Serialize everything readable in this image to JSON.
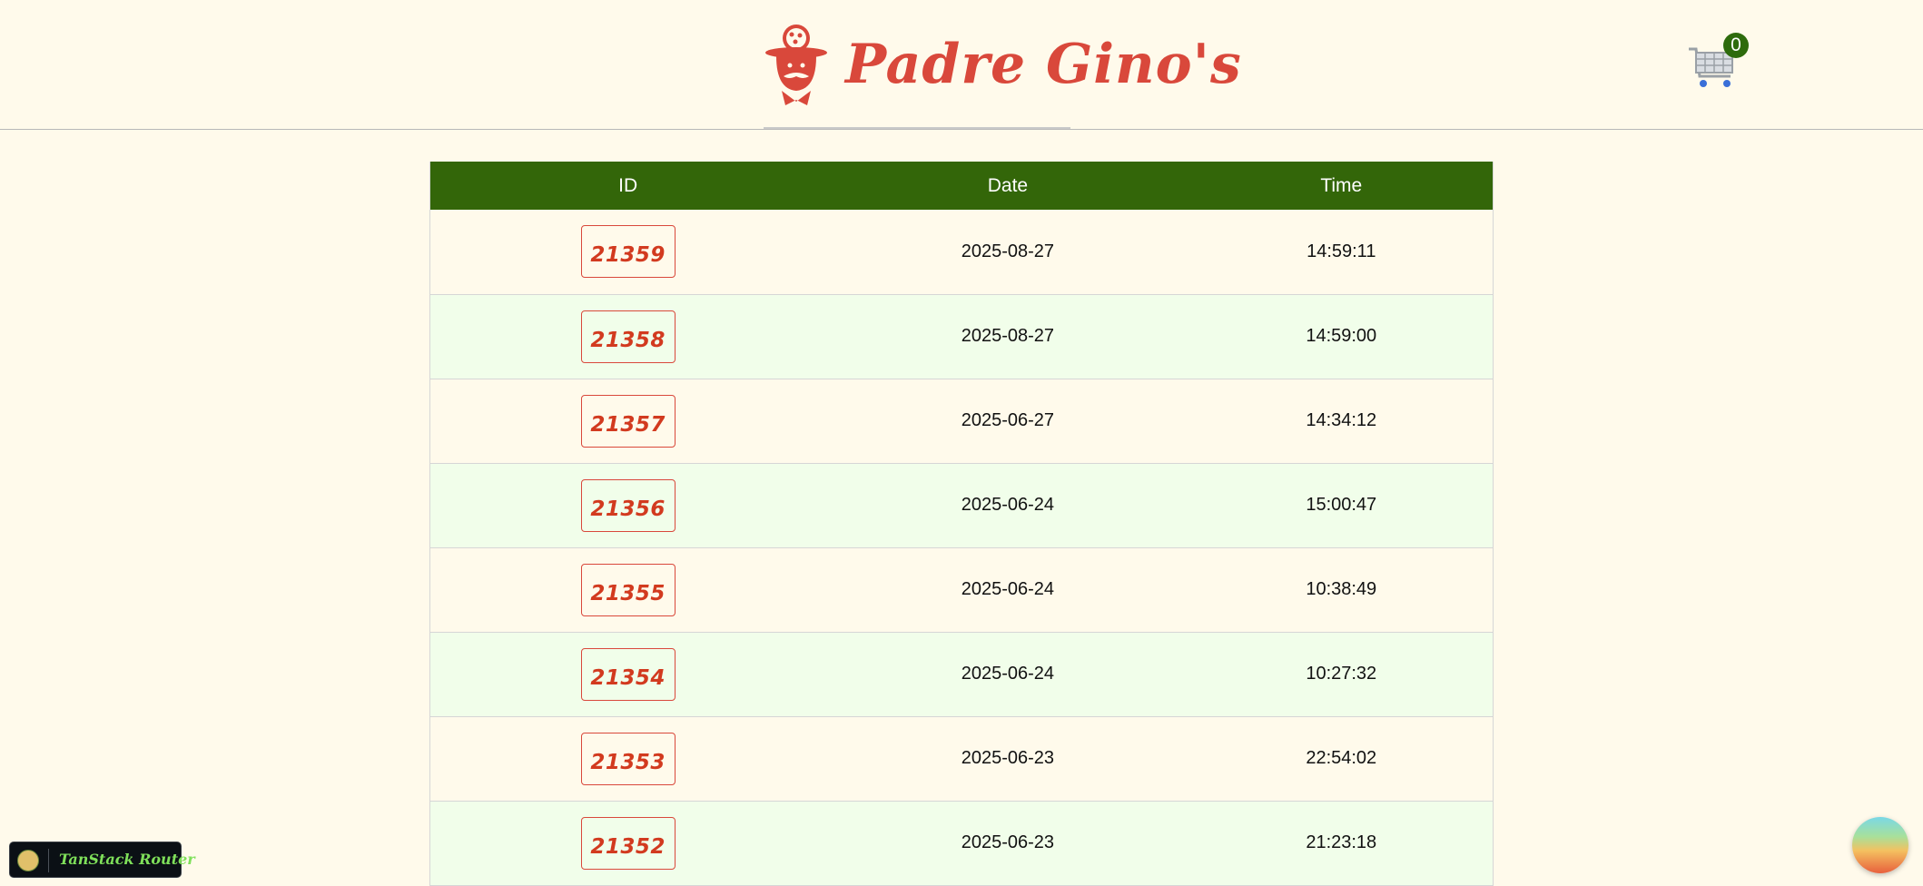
{
  "header": {
    "brand": "Padre Gino's",
    "logo_icon": "chef-logo-icon",
    "cart_icon": "shopping-cart-icon",
    "cart_count": "0"
  },
  "table": {
    "headers": {
      "id": "ID",
      "date": "Date",
      "time": "Time"
    },
    "rows": [
      {
        "id": "21359",
        "date": "2025-08-27",
        "time": "14:59:11"
      },
      {
        "id": "21358",
        "date": "2025-08-27",
        "time": "14:59:00"
      },
      {
        "id": "21357",
        "date": "2025-06-27",
        "time": "14:34:12"
      },
      {
        "id": "21356",
        "date": "2025-06-24",
        "time": "15:00:47"
      },
      {
        "id": "21355",
        "date": "2025-06-24",
        "time": "10:38:49"
      },
      {
        "id": "21354",
        "date": "2025-06-24",
        "time": "10:27:32"
      },
      {
        "id": "21353",
        "date": "2025-06-23",
        "time": "22:54:02"
      },
      {
        "id": "21352",
        "date": "2025-06-23",
        "time": "21:23:18"
      }
    ]
  },
  "devtools": {
    "label": "TanStack Router"
  },
  "colors": {
    "brand_red": "#d9483b",
    "header_green": "#336609",
    "background": "#fffaeb",
    "row_alt": "#f1feea"
  }
}
